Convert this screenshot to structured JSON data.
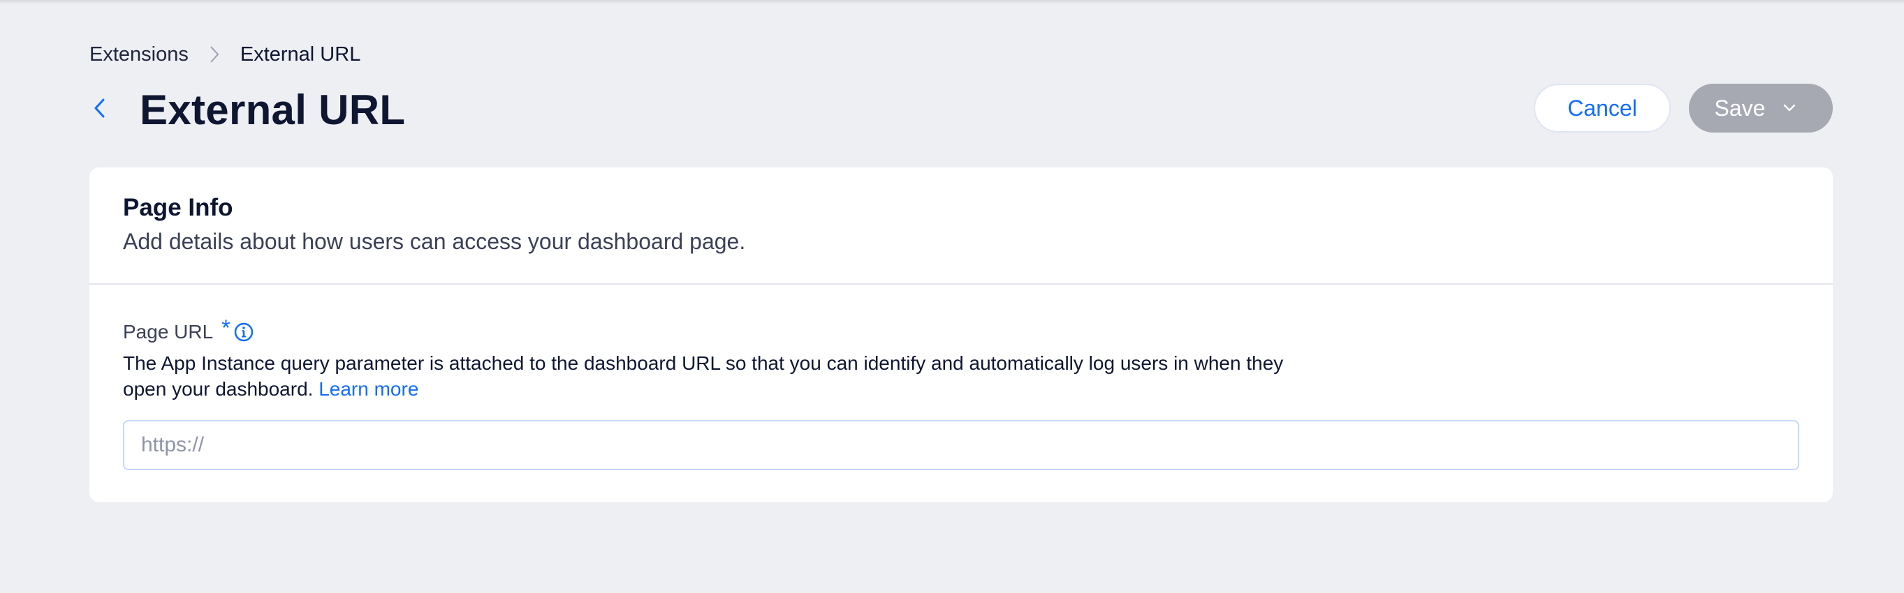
{
  "breadcrumb": {
    "items": [
      "Extensions",
      "External URL"
    ]
  },
  "header": {
    "title": "External URL",
    "cancel_label": "Cancel",
    "save_label": "Save"
  },
  "icons": {
    "back": "chevron-left-icon",
    "breadcrumb_separator": "chevron-right-icon",
    "save_dropdown": "chevron-down-icon",
    "info": "info-icon"
  },
  "card": {
    "title": "Page Info",
    "subtitle": "Add details about how users can access your dashboard page.",
    "field": {
      "label": "Page URL",
      "required_mark": "*",
      "description": "The App Instance query parameter is attached to the dashboard URL so that you can identify and automatically log users in when they open your dashboard.",
      "learn_more": "Learn more",
      "value": "",
      "placeholder": "https://"
    }
  },
  "colors": {
    "accent": "#116dff",
    "background": "#eeeff3",
    "save_disabled": "#a7a9b2",
    "text_primary": "#0f1632"
  }
}
